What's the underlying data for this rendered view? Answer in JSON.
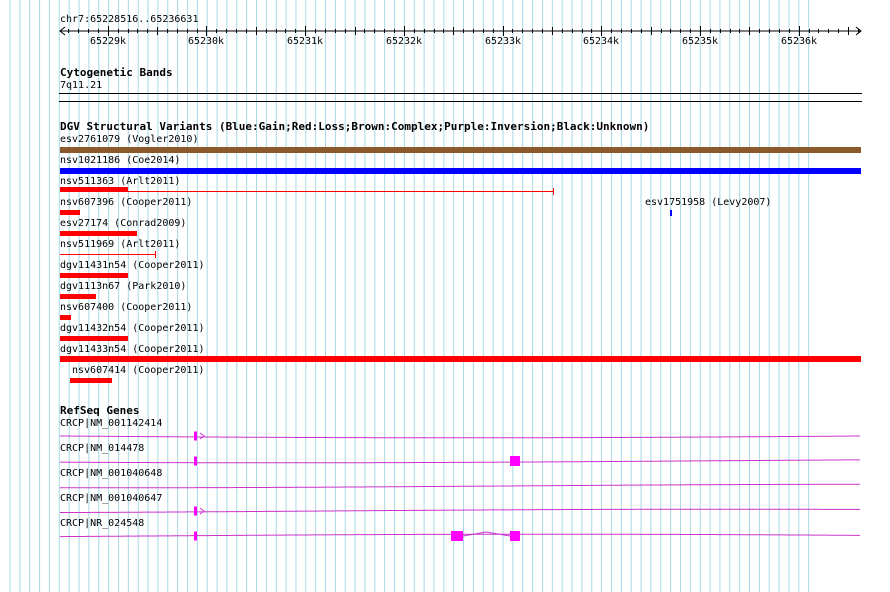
{
  "view": {
    "chrom": "chr7",
    "start": 65228516,
    "end": 65236631,
    "coord_label": "chr7:65228516..65236631",
    "ticks": [
      "65229k",
      "65230k",
      "65231k",
      "65232k",
      "65233k",
      "65234k",
      "65235k",
      "65236k"
    ]
  },
  "colors": {
    "grid": "#a8d8e8",
    "gain": "#0000ff",
    "loss": "#ff0000",
    "complex": "#8b5a2b",
    "gene": "#cc33cc",
    "exon": "#ff00ff"
  },
  "cytoband": {
    "title": "Cytogenetic Bands",
    "band": "7q11.21"
  },
  "dgv": {
    "title": "DGV Structural Variants (Blue:Gain;Red:Loss;Brown:Complex;Purple:Inversion;Black:Unknown)",
    "variants": [
      {
        "label": "esv2761079 (Vogler2010)",
        "start": 65228516,
        "end": 65236631,
        "type": "complex",
        "style": "bar"
      },
      {
        "label": "nsv1021186 (Coe2014)",
        "start": 65228516,
        "end": 65236631,
        "type": "gain",
        "style": "bar"
      },
      {
        "label": "nsv511363 (Arlt2011)",
        "start": 65228516,
        "end": 65233520,
        "type": "loss",
        "style": "line",
        "solid_end": 65229200
      },
      {
        "label": "nsv607396 (Cooper2011)",
        "start": 65228516,
        "end": 65228716,
        "type": "loss",
        "style": "bar"
      },
      {
        "label": "esv1751958 (Levy2007)",
        "start": 65234700,
        "end": 65234712,
        "type": "gain",
        "style": "bar"
      },
      {
        "label": "esv27174 (Conrad2009)",
        "start": 65228516,
        "end": 65229300,
        "type": "loss",
        "style": "bar"
      },
      {
        "label": "nsv511969 (Arlt2011)",
        "start": 65228516,
        "end": 65229490,
        "type": "loss",
        "style": "line"
      },
      {
        "label": "dgv11431n54 (Cooper2011)",
        "start": 65228516,
        "end": 65229200,
        "type": "loss",
        "style": "bar"
      },
      {
        "label": "dgv1113n67 (Park2010)",
        "start": 65228516,
        "end": 65228880,
        "type": "loss",
        "style": "bar"
      },
      {
        "label": "nsv607400 (Cooper2011)",
        "start": 65228516,
        "end": 65228630,
        "type": "loss",
        "style": "bar"
      },
      {
        "label": "dgv11432n54 (Cooper2011)",
        "start": 65228516,
        "end": 65229200,
        "type": "loss",
        "style": "bar"
      },
      {
        "label": "dgv11433n54 (Cooper2011)",
        "start": 65228516,
        "end": 65236631,
        "type": "loss",
        "style": "bar"
      },
      {
        "label": "nsv607414 (Cooper2011)",
        "start": 65228620,
        "end": 65229040,
        "type": "loss",
        "style": "bar"
      }
    ]
  },
  "refseq": {
    "title": "RefSeq Genes",
    "genes": [
      {
        "label": "CRCP|NM_001142414",
        "exons": [
          [
            65229870,
            65229900
          ]
        ],
        "strand": "+"
      },
      {
        "label": "CRCP|NM_014478",
        "exons": [
          [
            65229870,
            65229900
          ],
          [
            65233080,
            65233180
          ]
        ],
        "strand": ""
      },
      {
        "label": "CRCP|NM_001040648",
        "exons": [],
        "strand": ""
      },
      {
        "label": "CRCP|NM_001040647",
        "exons": [
          [
            65229870,
            65229900
          ]
        ],
        "strand": "+"
      },
      {
        "label": "CRCP|NR_024548",
        "exons": [
          [
            65229870,
            65229900
          ],
          [
            65232480,
            65232600
          ],
          [
            65233080,
            65233180
          ]
        ],
        "strand": ""
      }
    ]
  }
}
